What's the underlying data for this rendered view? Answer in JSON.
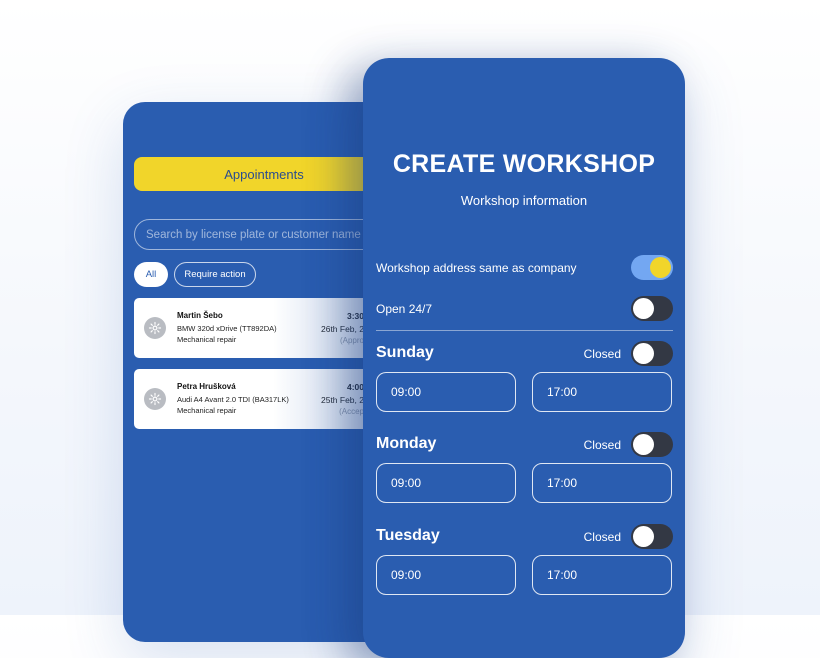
{
  "colors": {
    "primary": "#2a5db0",
    "accent": "#f1d52a",
    "toggle_on": "#73a7f2",
    "toggle_off": "#333844"
  },
  "appointments_screen": {
    "header_button": "Appointments",
    "search_placeholder": "Search by license plate or customer name",
    "filters": [
      "All",
      "Require action"
    ],
    "cards": [
      {
        "icon": "gear-icon",
        "name": "Martin Šebo",
        "car": "BMW 320d xDrive (TT892DA)",
        "service": "Mechanical repair",
        "time": "3:30",
        "date": "26th Feb, 2",
        "status": "(Appro"
      },
      {
        "icon": "gear-icon",
        "name": "Petra Hrušková",
        "car": "Audi A4 Avant 2.0 TDI (BA317LK)",
        "service": "Mechanical repair",
        "time": "4:00",
        "date": "25th Feb, 2",
        "status": "(Accep"
      }
    ]
  },
  "create_workshop": {
    "title": "CREATE WORKSHOP",
    "subtitle": "Workshop information",
    "options": [
      {
        "label": "Workshop address same as company",
        "on": true
      },
      {
        "label": "Open 24/7",
        "on": false
      }
    ],
    "days": [
      {
        "name": "Sunday",
        "closed_label": "Closed",
        "closed": false,
        "open": "09:00",
        "close": "17:00"
      },
      {
        "name": "Monday",
        "closed_label": "Closed",
        "closed": false,
        "open": "09:00",
        "close": "17:00"
      },
      {
        "name": "Tuesday",
        "closed_label": "Closed",
        "closed": false,
        "open": "09:00",
        "close": "17:00"
      }
    ]
  }
}
